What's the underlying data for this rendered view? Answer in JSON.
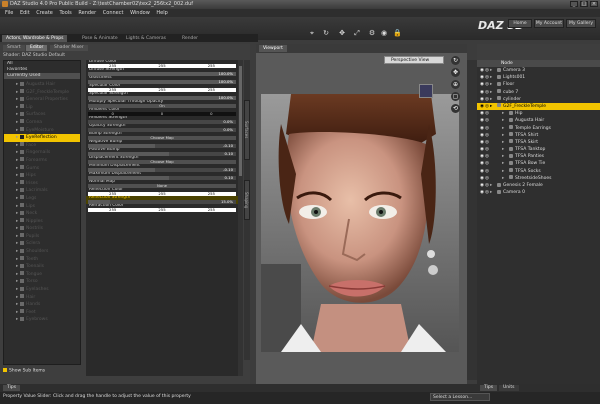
{
  "window": {
    "title": "DAZ Studio 4.0 Pro Public Build - Z:\\testChamber02\\tex2_256tx2_002.duf",
    "controls": [
      "_",
      "□",
      "×"
    ]
  },
  "menu": [
    "File",
    "Edit",
    "Create",
    "Tools",
    "Render",
    "Connect",
    "Window",
    "Help"
  ],
  "brand": {
    "logo": "DAZ 3D",
    "logo_part1": "DAZ",
    "logo_part2": "3D"
  },
  "nav_buttons": [
    "Home",
    "My Account",
    "My Gallery"
  ],
  "lesson_tabs": [
    "Actors, Wardrobe & Props",
    "Pose & Animate",
    "Lights & Cameras",
    "Render"
  ],
  "left_panel": {
    "tabs": [
      "Smart",
      "Editor",
      "Shader Mixer"
    ],
    "shader_label": "Shader: DAZ Studio Default",
    "filter_items": [
      "All",
      "Favorites",
      "Currently Used"
    ],
    "tree_items": [
      {
        "label": "Augusta Hair",
        "hl": false
      },
      {
        "label": "G2F_FreckleTemple",
        "hl": false
      },
      {
        "label": "General Properties",
        "hl": false
      },
      {
        "label": "Lip",
        "hl": false
      },
      {
        "label": "Surfaces",
        "hl": false
      },
      {
        "label": "Cornea",
        "hl": false
      },
      {
        "label": "EyeMoisture",
        "hl": false
      },
      {
        "label": "EyeReflection",
        "hl": true
      },
      {
        "label": "Face",
        "hl": false
      },
      {
        "label": "Fingernails",
        "hl": false
      },
      {
        "label": "Forearms",
        "hl": false
      },
      {
        "label": "Gums",
        "hl": false
      },
      {
        "label": "Hips",
        "hl": false
      },
      {
        "label": "Irises",
        "hl": false
      },
      {
        "label": "Lacrimals",
        "hl": false
      },
      {
        "label": "Legs",
        "hl": false
      },
      {
        "label": "Lips",
        "hl": false
      },
      {
        "label": "Neck",
        "hl": false
      },
      {
        "label": "Nipples",
        "hl": false
      },
      {
        "label": "Nostrils",
        "hl": false
      },
      {
        "label": "Pupils",
        "hl": false
      },
      {
        "label": "Sclera",
        "hl": false
      },
      {
        "label": "Shoulders",
        "hl": false
      },
      {
        "label": "Teeth",
        "hl": false
      },
      {
        "label": "Toenails",
        "hl": false
      },
      {
        "label": "Tongue",
        "hl": false
      },
      {
        "label": "Torso",
        "hl": false
      },
      {
        "label": "Eyelashes",
        "hl": false
      },
      {
        "label": "Hair",
        "hl": false
      },
      {
        "label": "Hands",
        "hl": false
      },
      {
        "label": "Feet",
        "hl": false
      },
      {
        "label": "Eyebrows",
        "hl": false
      }
    ],
    "show_sub_items": "Show Sub Items"
  },
  "properties": [
    {
      "label": "Diffuse Color",
      "kind": "color",
      "values": [
        "255",
        "255",
        "255"
      ]
    },
    {
      "label": "Diffuse Strength",
      "kind": "slider",
      "value": "100.0%",
      "fill": 1.0
    },
    {
      "label": "Glossiness",
      "kind": "slider",
      "value": "100.0%",
      "fill": 1.0
    },
    {
      "label": "Specular Color",
      "kind": "color",
      "values": [
        "255",
        "255",
        "255"
      ]
    },
    {
      "label": "Specular Strength",
      "kind": "slider",
      "value": "100.0%",
      "fill": 1.0
    },
    {
      "label": "Multiply Specular Through Opacity",
      "kind": "button",
      "value": "On"
    },
    {
      "label": "Ambient Color",
      "kind": "colordark",
      "values": [
        "0",
        "0",
        "0"
      ]
    },
    {
      "label": "Ambient Strength",
      "kind": "slider",
      "value": "0.0%",
      "fill": 0.0
    },
    {
      "label": "Opacity Strength",
      "kind": "slider",
      "value": "0.0%",
      "fill": 0.0
    },
    {
      "label": "Bump Strength",
      "kind": "button",
      "value": "Choose Map"
    },
    {
      "label": "Negative Bump",
      "kind": "slider",
      "value": "-0.10",
      "fill": 0.45
    },
    {
      "label": "Positive Bump",
      "kind": "slider",
      "value": "0.10",
      "fill": 0.55
    },
    {
      "label": "Displacement Strength",
      "kind": "button",
      "value": "Choose Map"
    },
    {
      "label": "Minimum Displacement",
      "kind": "slider",
      "value": "-0.10",
      "fill": 0.45
    },
    {
      "label": "Maximum Displacement",
      "kind": "slider",
      "value": "0.10",
      "fill": 0.55
    },
    {
      "label": "Normal Map",
      "kind": "button",
      "value": "None"
    },
    {
      "label": "Reflection Color",
      "kind": "color",
      "values": [
        "255",
        "255",
        "255"
      ]
    },
    {
      "label": "Reflection Strength",
      "kind": "sliderhl",
      "value": "15.0%",
      "fill": 0.15
    },
    {
      "label": "Refraction Color",
      "kind": "color",
      "values": [
        "255",
        "255",
        "255"
      ]
    }
  ],
  "side_tabs": [
    "Surfaces",
    "Shaping"
  ],
  "viewport": {
    "tab": "Viewport",
    "camera": "Perspective View"
  },
  "scene": {
    "header": "Node",
    "items": [
      {
        "label": "Camera 3",
        "hl": false,
        "indent": 0
      },
      {
        "label": "Lights001",
        "hl": false,
        "indent": 0
      },
      {
        "label": "Floor",
        "hl": false,
        "indent": 0
      },
      {
        "label": "cube 7",
        "hl": false,
        "indent": 0
      },
      {
        "label": "cylinder",
        "hl": false,
        "indent": 0
      },
      {
        "label": "G2F_FreckleTemple",
        "hl": true,
        "indent": 0
      },
      {
        "label": "Hip",
        "hl": false,
        "indent": 1
      },
      {
        "label": "Augusta Hair",
        "hl": false,
        "indent": 1
      },
      {
        "label": "Temple Earrings",
        "hl": false,
        "indent": 1
      },
      {
        "label": "TFSA Shirt",
        "hl": false,
        "indent": 1
      },
      {
        "label": "TFSA Skirt",
        "hl": false,
        "indent": 1
      },
      {
        "label": "TFSA Tanktop",
        "hl": false,
        "indent": 1
      },
      {
        "label": "TFSA Panties",
        "hl": false,
        "indent": 1
      },
      {
        "label": "TFSA Bow Tie",
        "hl": false,
        "indent": 1
      },
      {
        "label": "TFSA Socks",
        "hl": false,
        "indent": 1
      },
      {
        "label": "StreetsideShoes",
        "hl": false,
        "indent": 1
      },
      {
        "label": "Genesis 2 Female",
        "hl": false,
        "indent": 0
      },
      {
        "label": "Camera 0",
        "hl": false,
        "indent": 0
      }
    ]
  },
  "bottom_tabs": [
    "Tips"
  ],
  "scene_bottom_tabs": [
    "Tips",
    "Units"
  ],
  "status": {
    "text": "Property Value Slider: Click and drag the handle to adjust the value of this property",
    "lesson_select": "Select a Lesson..."
  },
  "colors": {
    "accent": "#f2c400"
  }
}
